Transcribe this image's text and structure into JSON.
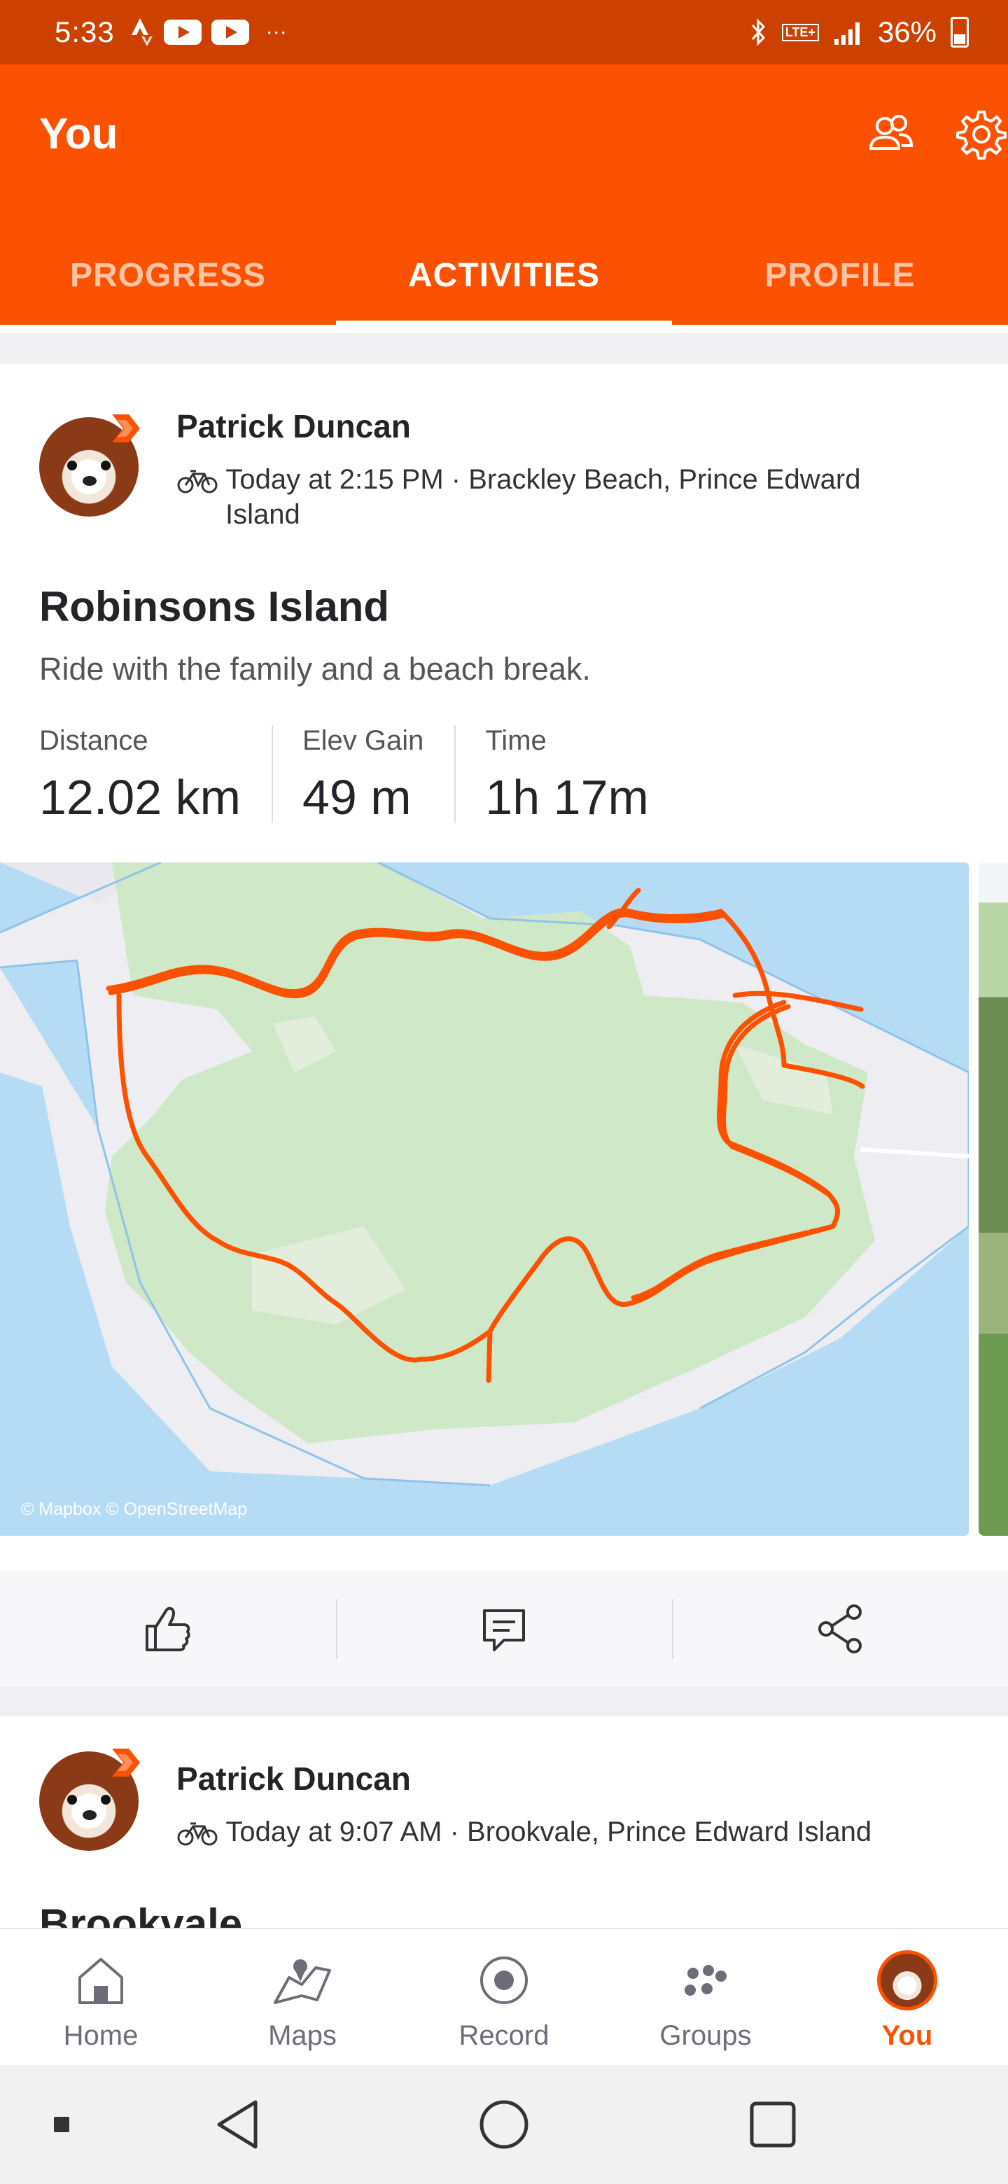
{
  "status_bar": {
    "time": "5:33",
    "battery": "36%",
    "network": "LTE+"
  },
  "header": {
    "title": "You",
    "icons": [
      "group-icon",
      "settings-gear-icon"
    ],
    "tabs": [
      {
        "label": "PROGRESS",
        "active": false
      },
      {
        "label": "ACTIVITIES",
        "active": true
      },
      {
        "label": "PROFILE",
        "active": false
      }
    ]
  },
  "feed": [
    {
      "athlete": "Patrick Duncan",
      "activity_type_icon": "bike-icon",
      "meta_line1": "Today at 2:15 PM · Brackley Beach, Prince Edward",
      "meta_line2": "Island",
      "title": "Robinsons Island",
      "description": "Ride with the family and a beach break.",
      "stats": [
        {
          "label": "Distance",
          "value": "12.02 km"
        },
        {
          "label": "Elev Gain",
          "value": "49 m"
        },
        {
          "label": "Time",
          "value": "1h 17m"
        }
      ],
      "map_attribution": "© Mapbox © OpenStreetMap"
    },
    {
      "athlete": "Patrick Duncan",
      "activity_type_icon": "bike-icon",
      "meta_line1": "Today at 9:07 AM · Brookvale, Prince Edward Island",
      "title": "Brookvale"
    }
  ],
  "actions": [
    {
      "name": "kudos",
      "icon": "thumbs-up-icon"
    },
    {
      "name": "comment",
      "icon": "comment-icon"
    },
    {
      "name": "share",
      "icon": "share-icon"
    }
  ],
  "bottom_nav": [
    {
      "label": "Home",
      "icon": "home-icon",
      "active": false
    },
    {
      "label": "Maps",
      "icon": "maps-icon",
      "active": false
    },
    {
      "label": "Record",
      "icon": "record-icon",
      "active": false
    },
    {
      "label": "Groups",
      "icon": "groups-icon",
      "active": false
    },
    {
      "label": "You",
      "icon": "avatar",
      "active": true
    }
  ],
  "colors": {
    "brand": "#fc5200",
    "status_bar": "#cc4100",
    "route": "#fc5200"
  }
}
